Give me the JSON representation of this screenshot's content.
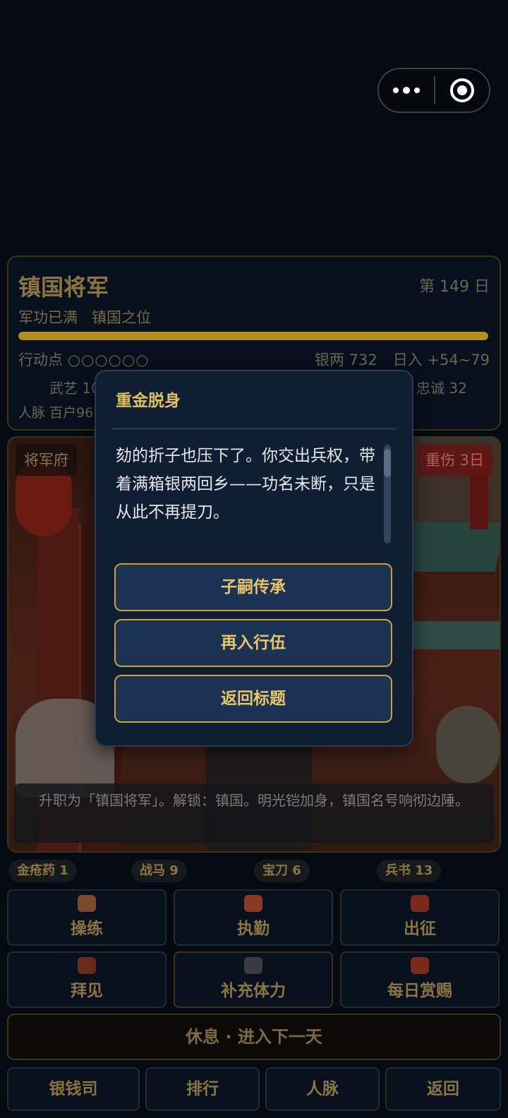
{
  "capsule": {
    "more_icon": "more-dots-icon",
    "close_icon": "target-close-icon"
  },
  "status": {
    "title": "镇国将军",
    "day": "第 149 日",
    "merit": "军功已满",
    "rank": "镇国之位",
    "progress": 1.0,
    "action_points_label": "行动点",
    "action_points": "○○○○○○",
    "silver": "银两 732",
    "daily_income": "日入 +54~79",
    "martial": "武艺 10",
    "loyalty": "忠诚 32",
    "connections": "人脉 百户96"
  },
  "scene": {
    "location": "将军府",
    "injury": "重伤 3日",
    "caption": "升职为「镇国将军」。解锁：镇国。明光铠加身，镇国名号响彻边陲。"
  },
  "items": [
    {
      "label": "金疮药 1"
    },
    {
      "label": "战马 9"
    },
    {
      "label": "宝刀 6"
    },
    {
      "label": "兵书 13"
    }
  ],
  "actions": [
    {
      "label": "操练",
      "icon": "training-icon",
      "color": "#7a4a2a"
    },
    {
      "label": "执勤",
      "icon": "duty-icon",
      "color": "#8a3a24"
    },
    {
      "label": "出征",
      "icon": "campaign-icon",
      "color": "#7a2a1a"
    },
    {
      "label": "拜见",
      "icon": "visit-icon",
      "color": "#6a2a1c"
    },
    {
      "label": "补充体力",
      "icon": "stamina-icon",
      "color": "#3a3a44"
    },
    {
      "label": "每日赏赐",
      "icon": "reward-icon",
      "color": "#7a2a1a"
    }
  ],
  "rest_label": "休息 · 进入下一天",
  "nav": [
    {
      "label": "银钱司"
    },
    {
      "label": "排行"
    },
    {
      "label": "人脉"
    },
    {
      "label": "返回"
    }
  ],
  "modal": {
    "title": "重金脱身",
    "body": "劾的折子也压下了。你交出兵权，带着满箱银两回乡——功名未断，只是从此不再提刀。",
    "buttons": [
      {
        "label": "子嗣传承"
      },
      {
        "label": "再入行伍"
      },
      {
        "label": "返回标题"
      }
    ]
  },
  "colors": {
    "accent": "#e2bf5e",
    "modal_bg": "#0f1e33",
    "button_border": "#c9a03e"
  }
}
